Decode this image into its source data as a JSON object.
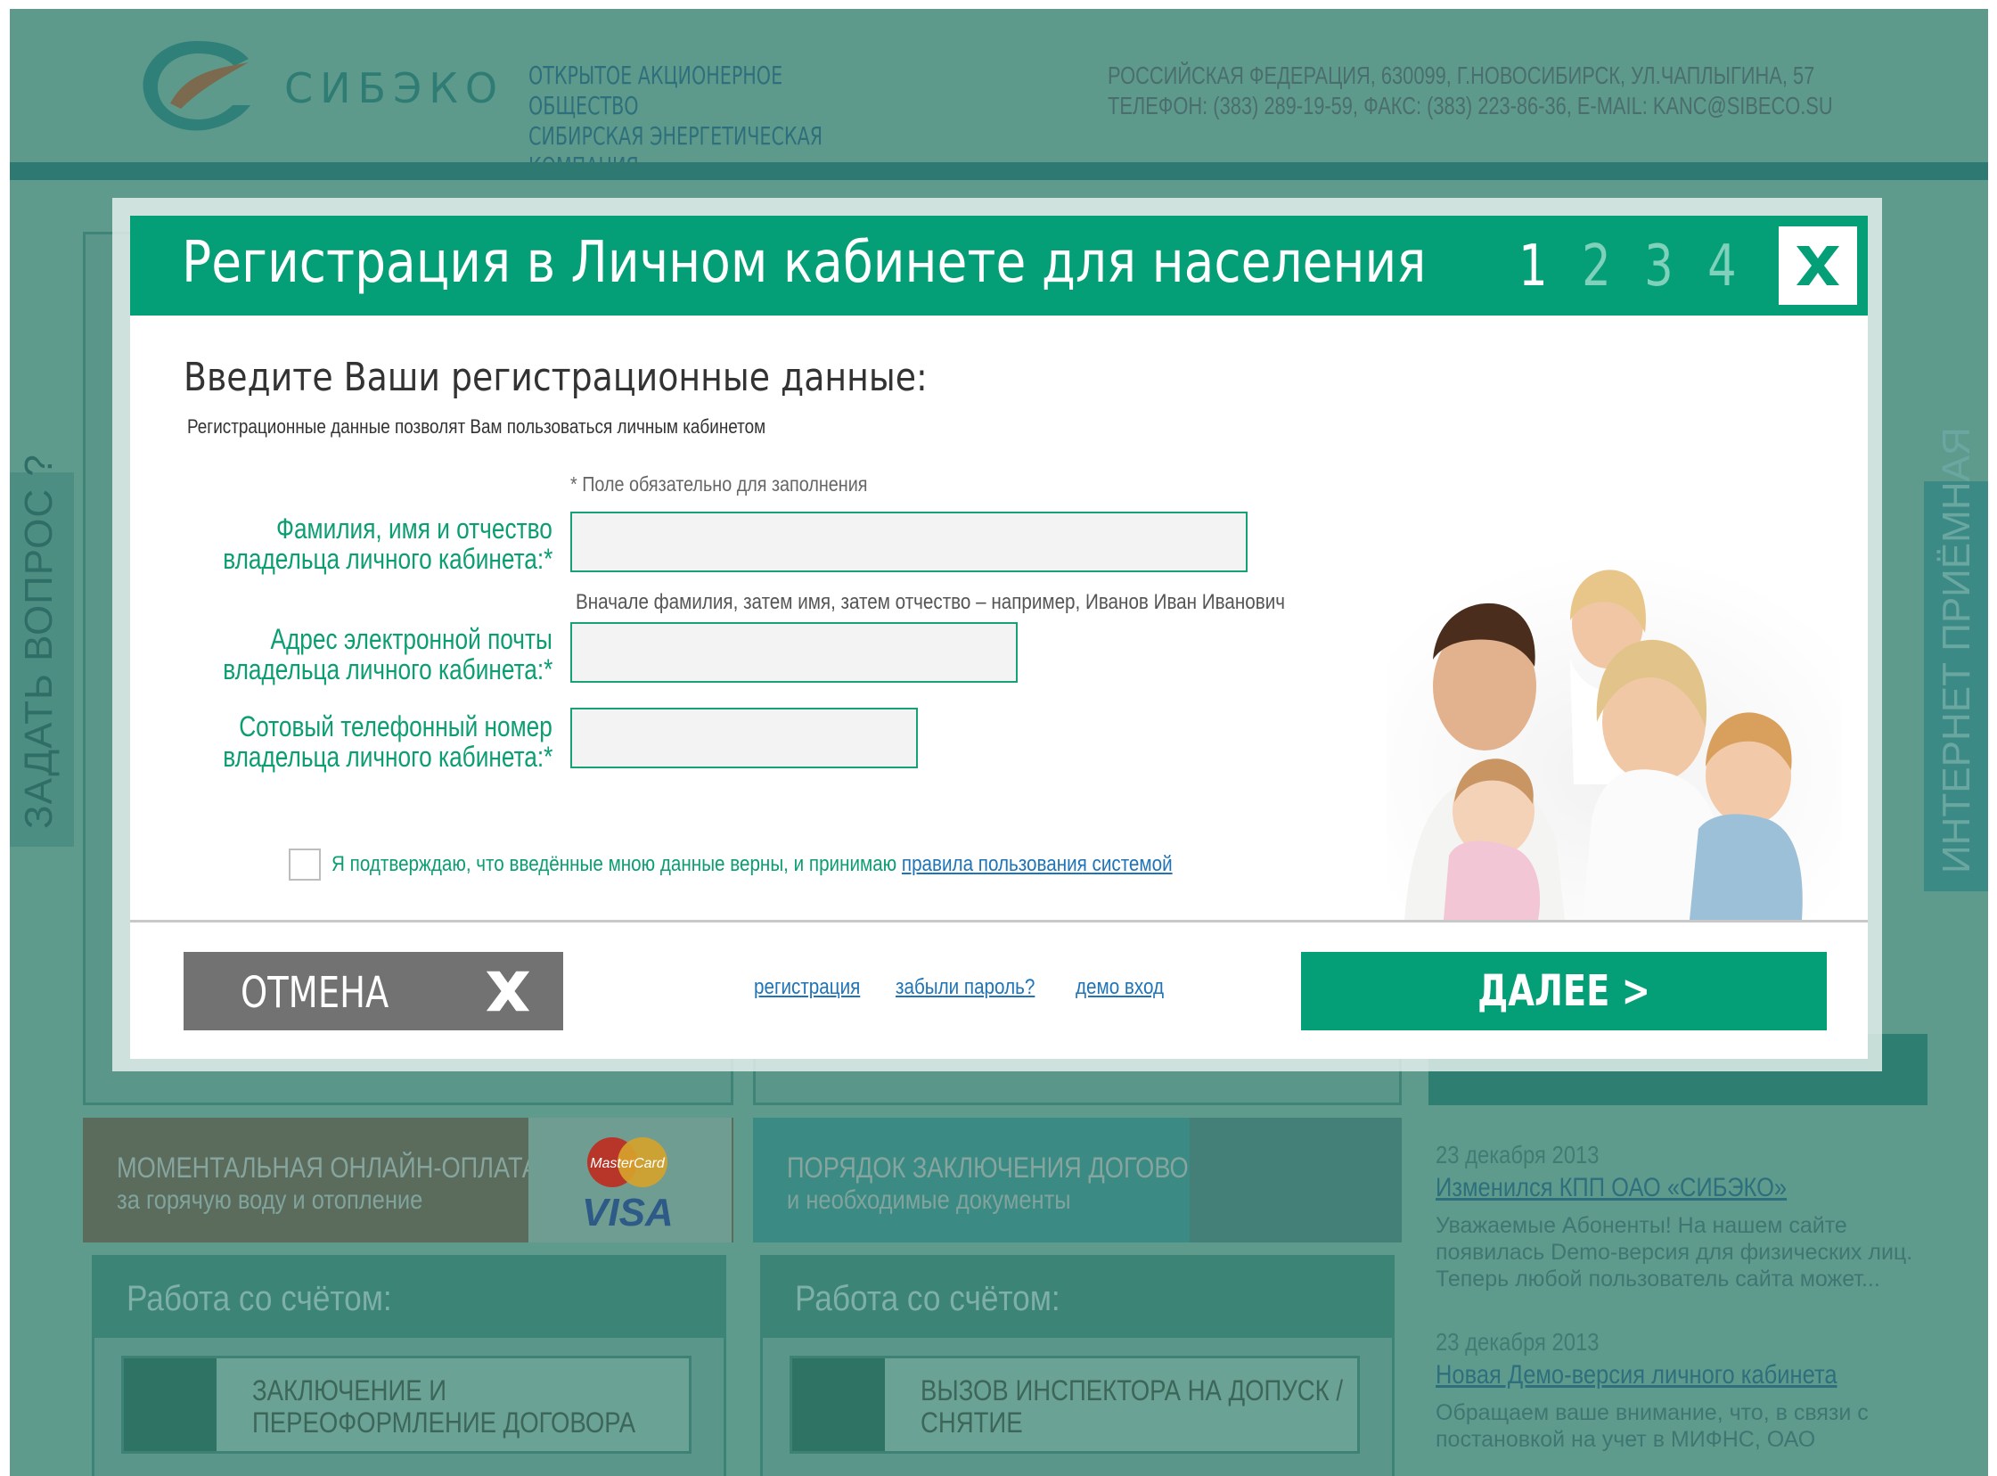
{
  "header": {
    "logo_text": "СИБЭКО",
    "org_line1": "ОТКРЫТОЕ АКЦИОНЕРНОЕ ОБЩЕСТВО",
    "org_line2": "СИБИРСКАЯ ЭНЕРГЕТИЧЕСКАЯ КОМПАНИЯ",
    "address": "РОССИЙСКАЯ ФЕДЕРАЦИЯ, 630099, Г.НОВОСИБИРСК, УЛ.ЧАПЛЫГИНА, 57",
    "phones": "ТЕЛЕФОН: (383) 289-19-59, ФАКС: (383) 223-86-36, E-MAIL: KANC@SIBECO.SU"
  },
  "side_tabs": {
    "left": "ЗАДАТЬ ВОПРОС ?",
    "right": "ИНТЕРНЕТ ПРИЁМНАЯ"
  },
  "promos": [
    {
      "title": "МОМЕНТАЛЬНАЯ ОНЛАЙН-ОПЛАТА",
      "subtitle": "за горячую воду и отопление",
      "card1": "MasterCard",
      "card2": "VISA"
    },
    {
      "title": "ПОРЯДОК ЗАКЛЮЧЕНИЯ ДОГОВОРА",
      "subtitle": "и необходимые документы"
    }
  ],
  "work_panels": [
    {
      "title": "Работа со счётом:",
      "item": "ЗАКЛЮЧЕНИЕ И ПЕРЕОФОРМЛЕНИЕ ДОГОВОРА"
    },
    {
      "title": "Работа со счётом:",
      "item": "ВЫЗОВ ИНСПЕКТОРА НА ДОПУСК / СНЯТИЕ"
    }
  ],
  "news": [
    {
      "date": "23 декабря 2013",
      "title": "Изменился КПП ОАО «СИБЭКО»",
      "text": "Уважаемые Абоненты! На нашем сайте появилась Demo-версия для физических лиц. Теперь любой пользователь сайта может..."
    },
    {
      "date": "23 декабря 2013",
      "title": "Новая Демо-версия личного кабинета",
      "text": "Обращаем ваше внимание, что, в связи с постановкой на учет в МИФНС, ОАО"
    }
  ],
  "modal": {
    "title": "Регистрация в Личном кабинете для населения",
    "steps": [
      "1",
      "2",
      "3",
      "4"
    ],
    "active_step": 1,
    "heading": "Введите Ваши регистрационные данные:",
    "subheading": "Регистрационные данные позволят Вам пользоваться личным кабинетом",
    "required_note": "* Поле обязательно для заполнения",
    "fields": {
      "fio_label_1": "Фамилия, имя и отчество",
      "fio_label_2": "владельца личного кабинета:*",
      "fio_value": "",
      "fio_hint": "Вначале фамилия, затем имя, затем отчество – например, Иванов Иван Иванович",
      "email_label_1": "Адрес электронной почты",
      "email_label_2": "владельца личного кабинета:*",
      "email_value": "",
      "phone_label_1": "Сотовый телефонный номер",
      "phone_label_2": "владельца личного кабинета:*",
      "phone_value": ""
    },
    "agree_text": "Я подтверждаю, что введённые мною данные верны, и принимаю",
    "agree_link": "правила пользования системой",
    "agree_checked": false,
    "cancel_label": "ОТМЕНА",
    "links": [
      "регистрация",
      "забыли пароль?",
      "демо вход"
    ],
    "next_label": "ДАЛЕЕ >"
  },
  "colors": {
    "brand_green": "#049f76",
    "label_green": "#0c9e72",
    "link_blue": "#1f74b8",
    "cancel_gray": "#727272"
  }
}
